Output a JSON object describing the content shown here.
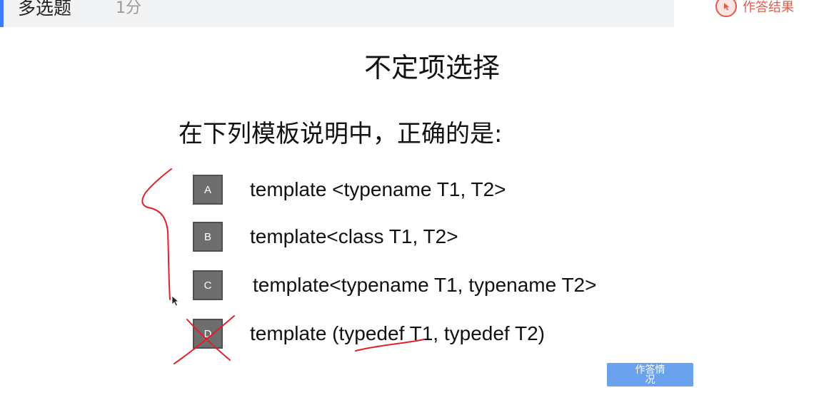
{
  "header": {
    "question_type": "多选题",
    "score": "1分",
    "result_button": "作答结果",
    "result_icon": "pointer-icon"
  },
  "slide": {
    "title": "不定项选择",
    "question": "在下列模板说明中，正确的是:",
    "options": [
      {
        "letter": "A",
        "text": "template <typename T1, T2>"
      },
      {
        "letter": "B",
        "text": "template<class T1, T2>"
      },
      {
        "letter": "C",
        "text": "template<typename T1, typename T2>"
      },
      {
        "letter": "D",
        "text": "template (typedef T1, typedef T2)"
      }
    ]
  },
  "status_button": "作答情况",
  "colors": {
    "accent": "#3d7df5",
    "result_red": "#e25b4b",
    "option_box": "#6e6e6e",
    "status_button": "#6aa2ee",
    "ink": "#e0202a"
  }
}
